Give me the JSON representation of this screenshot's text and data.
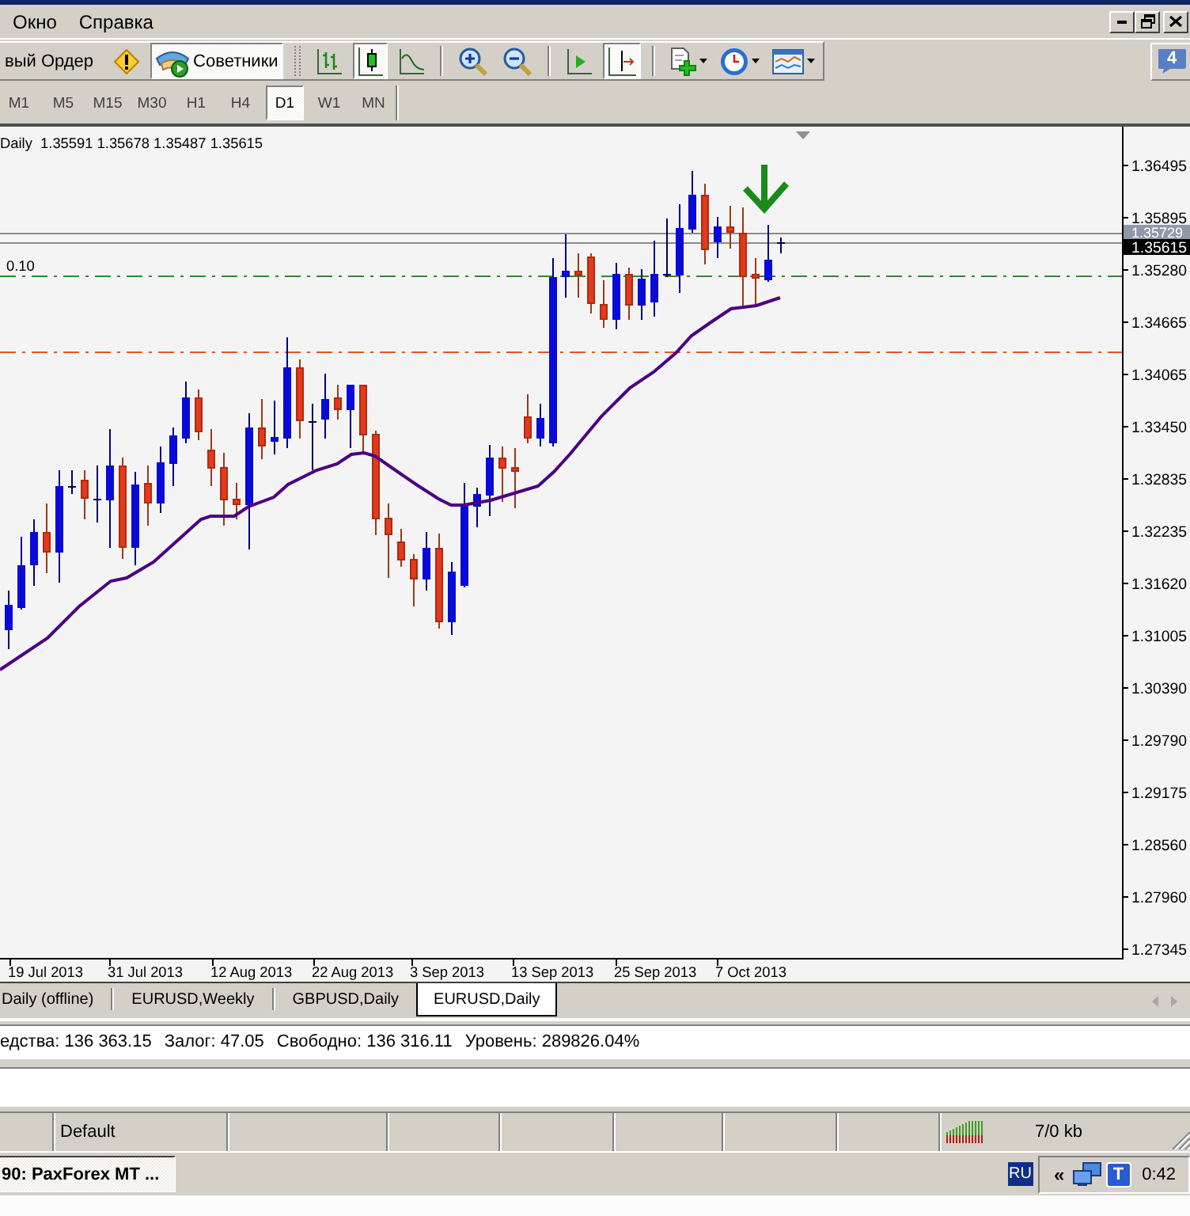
{
  "menu": [
    {
      "label": "Окно"
    },
    {
      "label": "Справка"
    }
  ],
  "toolbar": {
    "groups": [
      {
        "tools": [
          {
            "kind": "text",
            "label": "вый Ордер",
            "pressed": false
          },
          {
            "kind": "icon",
            "pressed": false
          },
          {
            "kind": "text",
            "label": "Советники",
            "pressed": true
          }
        ]
      },
      {
        "tools": [
          {
            "kind": "icon",
            "pressed": false
          },
          {
            "kind": "icon",
            "pressed": true
          },
          {
            "kind": "icon",
            "pressed": false
          }
        ]
      },
      {
        "tools": [
          {
            "kind": "icon",
            "pressed": false
          },
          {
            "kind": "icon",
            "pressed": false
          }
        ]
      },
      {
        "tools": [
          {
            "kind": "icon",
            "pressed": false
          },
          {
            "kind": "icon",
            "pressed": true
          }
        ]
      },
      {
        "tools": [
          {
            "kind": "dropdown",
            "pressed": false
          },
          {
            "kind": "dropdown",
            "pressed": false
          },
          {
            "kind": "dropdown",
            "pressed": false
          }
        ]
      }
    ],
    "messages": {
      "count": "4"
    }
  },
  "timeframes": [
    {
      "label": "M1",
      "selected": false
    },
    {
      "label": "M5",
      "selected": false
    },
    {
      "label": "M15",
      "selected": false
    },
    {
      "label": "M30",
      "selected": false
    },
    {
      "label": "H1",
      "selected": false
    },
    {
      "label": "H4",
      "selected": false
    },
    {
      "label": "D1",
      "selected": true
    },
    {
      "label": "W1",
      "selected": false
    },
    {
      "label": "MN",
      "selected": false
    }
  ],
  "chart": {
    "header": "Daily  1.35591 1.35678 1.35487 1.35615",
    "level_lines": [
      {
        "label": "0.10",
        "color": "#2e8b2e"
      },
      {
        "color": "#e8541e"
      }
    ],
    "ask_tag": "1.35729",
    "bid_tag": "1.35615",
    "price_axis": [
      "1.36495",
      "1.35895",
      "1.35280",
      "1.34665",
      "1.34065",
      "1.33450",
      "1.32835",
      "1.32235",
      "1.31620",
      "1.31005",
      "1.30390",
      "1.29790",
      "1.29175",
      "1.28560",
      "1.27960",
      "1.27345"
    ],
    "time_axis": [
      "19 Jul 2013",
      "31 Jul 2013",
      "12 Aug 2013",
      "22 Aug 2013",
      "3 Sep 2013",
      "13 Sep 2013",
      "25 Sep 2013",
      "7 Oct 2013"
    ]
  },
  "tabs": [
    {
      "label": "Daily (offline)",
      "selected": false
    },
    {
      "label": "EURUSD,Weekly",
      "selected": false
    },
    {
      "label": "GBPUSD,Daily",
      "selected": false
    },
    {
      "label": "EURUSD,Daily",
      "selected": true
    }
  ],
  "account": [
    "едства: 136 363.15",
    "Залог: 47.05",
    "Свободно: 136 316.11",
    "Уровень: 289826.04%"
  ],
  "status_bar": {
    "profile": "Default",
    "traffic": "7/0 kb"
  },
  "taskbar": {
    "task": {
      "label": "90: PaxForex MT ...",
      "selected": true
    },
    "language": "RU",
    "tray_expand": "«",
    "tray_app": "T",
    "clock": "0:42"
  }
}
